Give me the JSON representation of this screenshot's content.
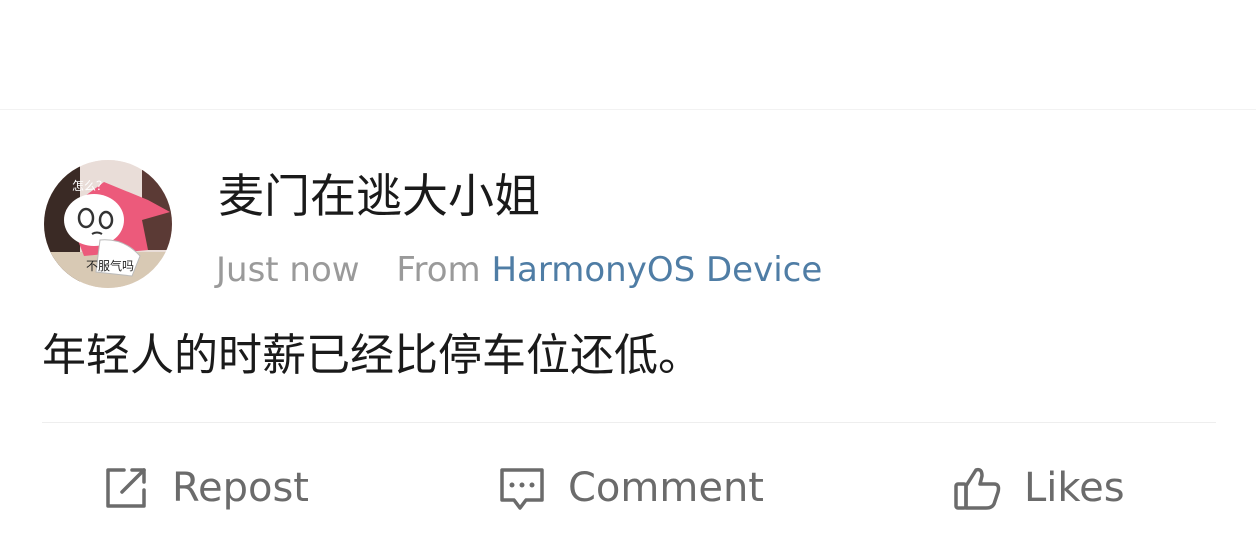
{
  "post": {
    "author": "麦门在逃大小姐",
    "time": "Just now",
    "from_prefix": "From",
    "device": "HarmonyOS Device",
    "text": "年轻人的时薪已经比停车位还低。"
  },
  "avatar": {
    "sticker_text_top": "怎么？",
    "sticker_text_bottom": "不服气吗"
  },
  "actions": {
    "repost": "Repost",
    "comment": "Comment",
    "likes": "Likes"
  },
  "colors": {
    "link": "#4f7da5",
    "meta": "#9a9a9a",
    "text": "#1a1a1a",
    "action": "#6b6b6b"
  },
  "icons": {
    "repost": "edit-share-icon",
    "comment": "comment-bubble-icon",
    "likes": "thumbs-up-icon"
  }
}
